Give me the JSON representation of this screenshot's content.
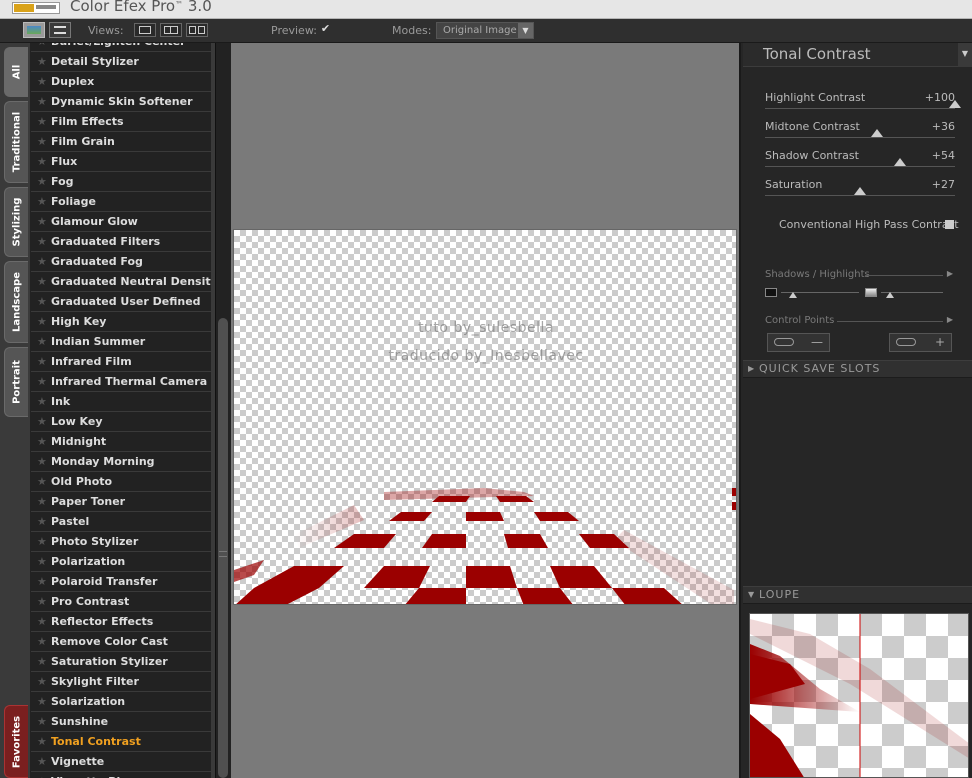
{
  "app": {
    "title": "Color Efex Pro",
    "title_tm": "™",
    "version": "3.0"
  },
  "toolbar": {
    "views_label": "Views:",
    "preview_label": "Preview:",
    "preview_checked": true,
    "modes_label": "Modes:",
    "mode_value": "Original Image"
  },
  "tabs": [
    {
      "label": "All"
    },
    {
      "label": "Traditional"
    },
    {
      "label": "Stylizing"
    },
    {
      "label": "Landscape"
    },
    {
      "label": "Portrait"
    },
    {
      "label": "Favorites"
    }
  ],
  "filters": [
    "Burlet/Lighten Center",
    "Detail Stylizer",
    "Duplex",
    "Dynamic Skin Softener",
    "Film Effects",
    "Film Grain",
    "Flux",
    "Fog",
    "Foliage",
    "Glamour Glow",
    "Graduated Filters",
    "Graduated Fog",
    "Graduated Neutral Density",
    "Graduated User Defined",
    "High Key",
    "Indian Summer",
    "Infrared Film",
    "Infrared Thermal Camera",
    "Ink",
    "Low Key",
    "Midnight",
    "Monday Morning",
    "Old Photo",
    "Paper Toner",
    "Pastel",
    "Photo Stylizer",
    "Polarization",
    "Polaroid Transfer",
    "Pro Contrast",
    "Reflector Effects",
    "Remove Color Cast",
    "Saturation Stylizer",
    "Skylight Filter",
    "Solarization",
    "Sunshine",
    "Tonal Contrast",
    "Vignette",
    "Vignette Blur"
  ],
  "selected_filter": "Tonal Contrast",
  "canvas": {
    "watermark_line1": "tuto by_sulesbella",
    "watermark_line2": "traducido by_Inesbellavec"
  },
  "panel": {
    "filter_name": "Tonal Contrast",
    "sliders": [
      {
        "label": "Highlight Contrast",
        "value": "+100",
        "level": 1.0
      },
      {
        "label": "Midtone Contrast",
        "value": "+36",
        "level": 0.59
      },
      {
        "label": "Shadow Contrast",
        "value": "+54",
        "level": 0.71
      },
      {
        "label": "Saturation",
        "value": "+27",
        "level": 0.5
      }
    ],
    "conventional_label": "Conventional High Pass Contrast",
    "conventional_checked": false,
    "shadows_highlights_label": "Shadows / Highlights",
    "control_points_label": "Control Points",
    "quick_save_label": "QUICK SAVE SLOTS",
    "loupe_label": "LOUPE"
  },
  "colors": {
    "accent_selected": "#f0a020",
    "checker_red": "#9b0000"
  }
}
